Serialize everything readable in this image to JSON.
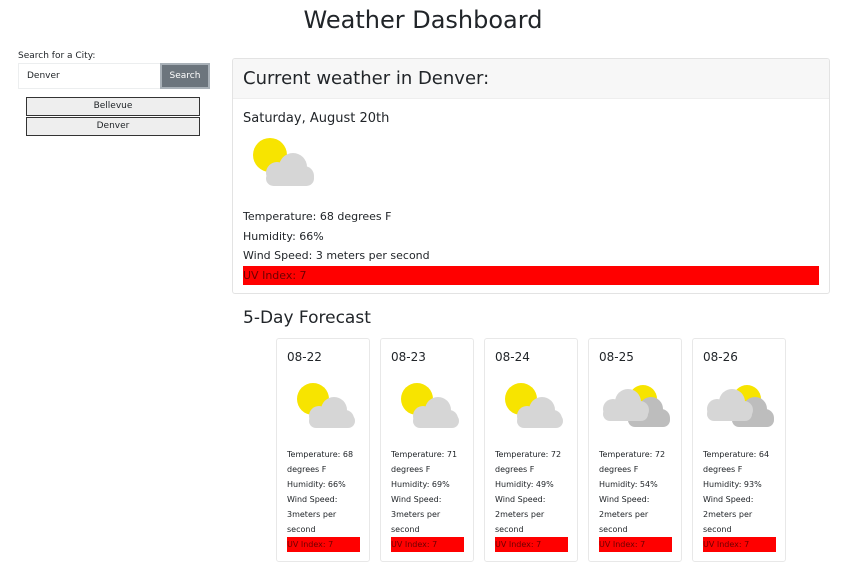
{
  "page_title": "Weather Dashboard",
  "search": {
    "label": "Search for a City:",
    "value": "Denver",
    "button_label": "Search"
  },
  "history": [
    "Bellevue",
    "Denver"
  ],
  "current": {
    "header": "Current weather in Denver:",
    "date": "Saturday, August 20th",
    "icon": "partly-cloudy-day-icon",
    "temperature": "Temperature: 68 degrees F",
    "humidity": "Humidity: 66%",
    "wind": "Wind Speed: 3 meters per second",
    "uv": "UV Index: 7"
  },
  "forecast_title": "5-Day Forecast",
  "forecast": [
    {
      "date": "08-22",
      "icon": "partly-cloudy-day-icon",
      "temp": "Temperature: 68 degrees F",
      "humidity": "Humidity: 66%",
      "wind": "Wind Speed: 3meters per second",
      "uv": "UV Index: 7"
    },
    {
      "date": "08-23",
      "icon": "partly-cloudy-day-icon",
      "temp": "Temperature: 71 degrees F",
      "humidity": "Humidity: 69%",
      "wind": "Wind Speed: 3meters per second",
      "uv": "UV Index: 7"
    },
    {
      "date": "08-24",
      "icon": "partly-cloudy-day-icon",
      "temp": "Temperature: 72 degrees F",
      "humidity": "Humidity: 49%",
      "wind": "Wind Speed: 2meters per second",
      "uv": "UV Index: 7"
    },
    {
      "date": "08-25",
      "icon": "broken-clouds-icon",
      "temp": "Temperature: 72 degrees F",
      "humidity": "Humidity: 54%",
      "wind": "Wind Speed: 2meters per second",
      "uv": "UV Index: 7"
    },
    {
      "date": "08-26",
      "icon": "broken-clouds-icon",
      "temp": "Temperature: 64 degrees F",
      "humidity": "Humidity: 93%",
      "wind": "Wind Speed: 2meters per second",
      "uv": "UV Index: 7"
    }
  ],
  "colors": {
    "uv_high": "#ff0000",
    "search_button": "#6c757d",
    "sun": "#f7e400",
    "cloud_light": "#d6d6d6",
    "cloud_dark": "#bdbdbd"
  }
}
